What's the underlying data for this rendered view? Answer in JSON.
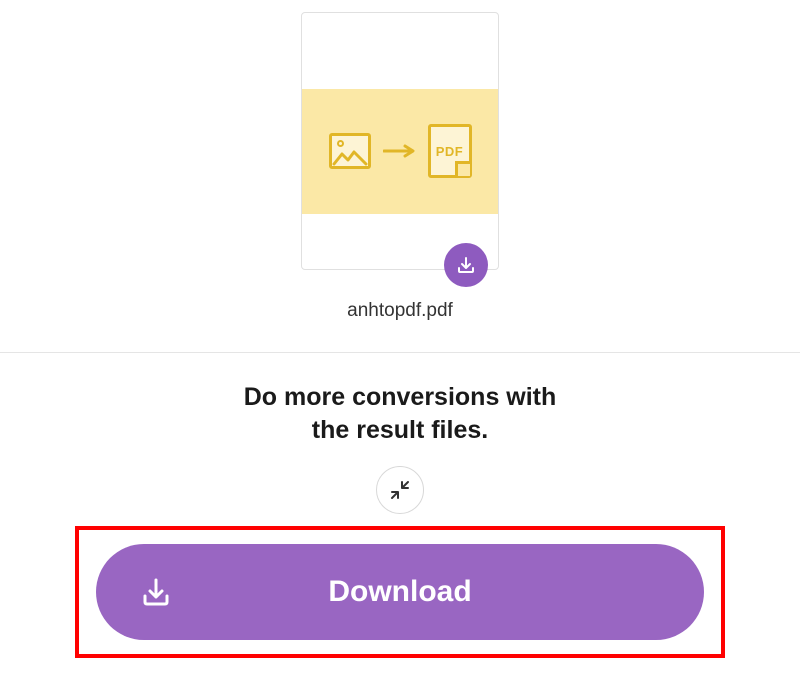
{
  "file": {
    "name": "anhtopdf.pdf",
    "pdf_label": "PDF"
  },
  "heading": {
    "line1": "Do more conversions with",
    "line2": "the result files."
  },
  "buttons": {
    "download": "Download"
  },
  "colors": {
    "accent": "#9966c2",
    "highlight": "#ff0000"
  }
}
